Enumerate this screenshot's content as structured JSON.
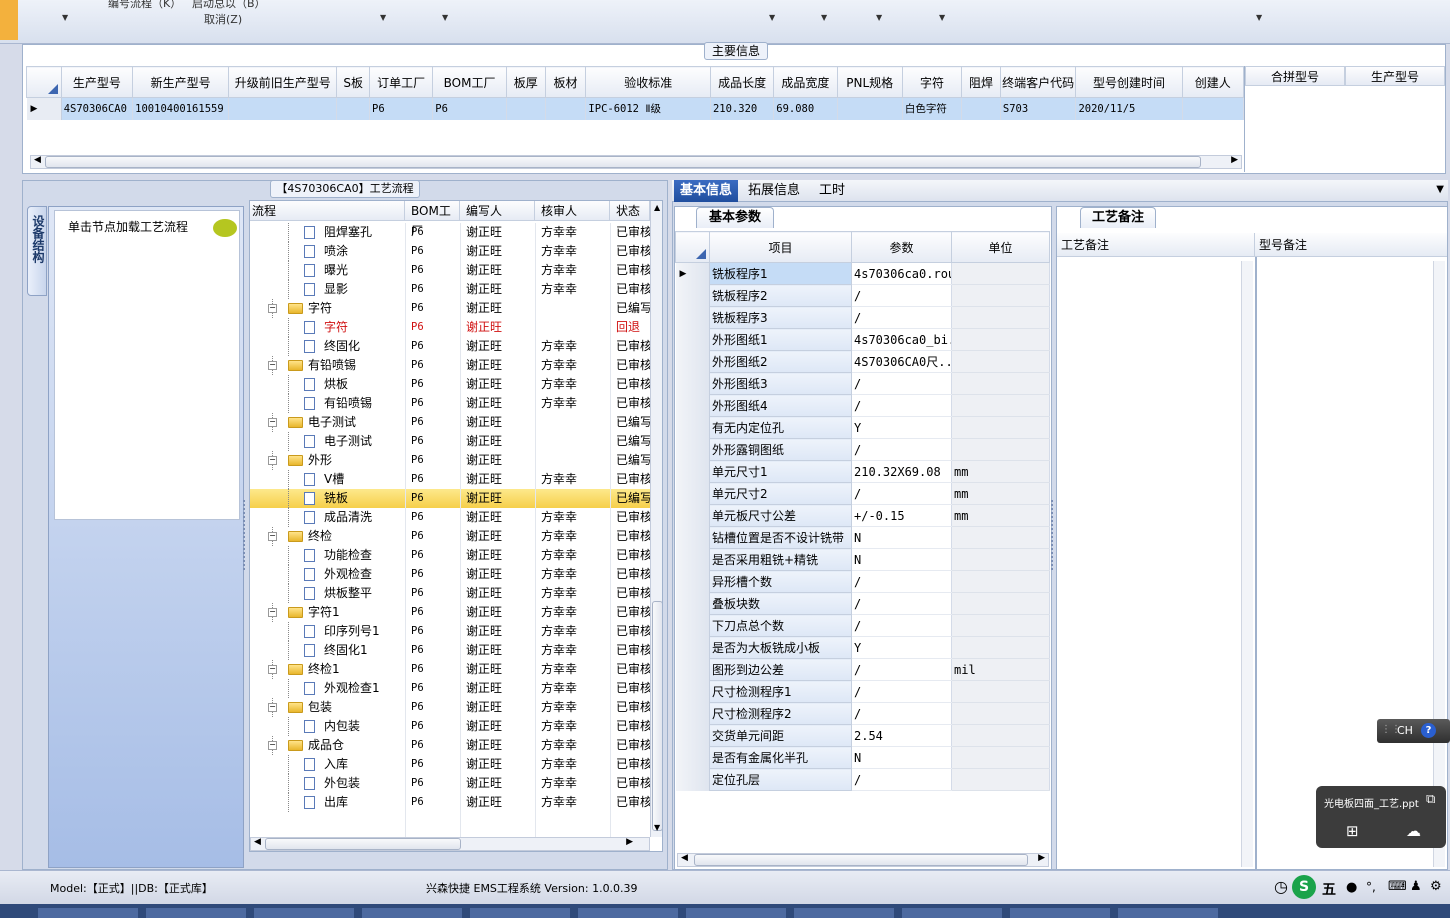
{
  "menu": {
    "item1": "编号流程（K）",
    "item2": "启动总以（B）",
    "item3": "取消(Z)"
  },
  "main_info": {
    "title": "主要信息",
    "columns": [
      "生产型号",
      "新生产型号",
      "升级前旧生产型号",
      "S板",
      "订单工厂",
      "BOM工厂",
      "板厚",
      "板材",
      "验收标准",
      "成品长度",
      "成品宽度",
      "PNL规格",
      "字符",
      "阻焊",
      "终端客户代码",
      "型号创建时间",
      "创建人"
    ],
    "row": [
      "4S70306CA0",
      "10010400161559",
      "",
      "",
      "P6",
      "P6",
      "",
      "",
      "IPC-6012 Ⅱ级",
      "210.320",
      "69.080",
      "",
      "白色字符",
      "",
      "S703",
      "2020/11/5",
      ""
    ],
    "side_columns": [
      "合拼型号",
      "生产型号"
    ]
  },
  "process": {
    "title": "【4S70306CA0】工艺流程",
    "side_tab": "设备结构",
    "load_hint": "单击节点加载工艺流程",
    "columns": [
      "流程",
      "BOM工厂",
      "编写人",
      "核审人",
      "状态"
    ],
    "rows": [
      {
        "name": "阻焊塞孔",
        "type": "file",
        "level": 1,
        "bom": "P6",
        "writer": "谢正旺",
        "reviewer": "方幸幸",
        "status": "已审核"
      },
      {
        "name": "喷涂",
        "type": "file",
        "level": 1,
        "bom": "P6",
        "writer": "谢正旺",
        "reviewer": "方幸幸",
        "status": "已审核"
      },
      {
        "name": "曝光",
        "type": "file",
        "level": 1,
        "bom": "P6",
        "writer": "谢正旺",
        "reviewer": "方幸幸",
        "status": "已审核"
      },
      {
        "name": "显影",
        "type": "file",
        "level": 1,
        "bom": "P6",
        "writer": "谢正旺",
        "reviewer": "方幸幸",
        "status": "已审核"
      },
      {
        "name": "字符",
        "type": "folder",
        "level": 0,
        "bom": "P6",
        "writer": "谢正旺",
        "reviewer": "",
        "status": "已编写"
      },
      {
        "name": "字符",
        "type": "file",
        "level": 1,
        "bom": "P6",
        "writer": "谢正旺",
        "reviewer": "",
        "status": "回退",
        "red": true
      },
      {
        "name": "终固化",
        "type": "file",
        "level": 1,
        "bom": "P6",
        "writer": "谢正旺",
        "reviewer": "方幸幸",
        "status": "已审核"
      },
      {
        "name": "有铅喷锡",
        "type": "folder",
        "level": 0,
        "bom": "P6",
        "writer": "谢正旺",
        "reviewer": "方幸幸",
        "status": "已审核"
      },
      {
        "name": "烘板",
        "type": "file",
        "level": 1,
        "bom": "P6",
        "writer": "谢正旺",
        "reviewer": "方幸幸",
        "status": "已审核"
      },
      {
        "name": "有铅喷锡",
        "type": "file",
        "level": 1,
        "bom": "P6",
        "writer": "谢正旺",
        "reviewer": "方幸幸",
        "status": "已审核"
      },
      {
        "name": "电子测试",
        "type": "folder",
        "level": 0,
        "bom": "P6",
        "writer": "谢正旺",
        "reviewer": "",
        "status": "已编写"
      },
      {
        "name": "电子测试",
        "type": "file",
        "level": 1,
        "bom": "P6",
        "writer": "谢正旺",
        "reviewer": "",
        "status": "已编写"
      },
      {
        "name": "外形",
        "type": "folder",
        "level": 0,
        "bom": "P6",
        "writer": "谢正旺",
        "reviewer": "",
        "status": "已编写"
      },
      {
        "name": "V槽",
        "type": "file",
        "level": 1,
        "bom": "P6",
        "writer": "谢正旺",
        "reviewer": "方幸幸",
        "status": "已审核"
      },
      {
        "name": "铣板",
        "type": "file",
        "level": 1,
        "bom": "P6",
        "writer": "谢正旺",
        "reviewer": "",
        "status": "已编写",
        "selected": true
      },
      {
        "name": "成品清洗",
        "type": "file",
        "level": 1,
        "bom": "P6",
        "writer": "谢正旺",
        "reviewer": "方幸幸",
        "status": "已审核"
      },
      {
        "name": "终检",
        "type": "folder",
        "level": 0,
        "bom": "P6",
        "writer": "谢正旺",
        "reviewer": "方幸幸",
        "status": "已审核"
      },
      {
        "name": "功能检查",
        "type": "file",
        "level": 1,
        "bom": "P6",
        "writer": "谢正旺",
        "reviewer": "方幸幸",
        "status": "已审核"
      },
      {
        "name": "外观检查",
        "type": "file",
        "level": 1,
        "bom": "P6",
        "writer": "谢正旺",
        "reviewer": "方幸幸",
        "status": "已审核"
      },
      {
        "name": "烘板整平",
        "type": "file",
        "level": 1,
        "bom": "P6",
        "writer": "谢正旺",
        "reviewer": "方幸幸",
        "status": "已审核"
      },
      {
        "name": "字符1",
        "type": "folder",
        "level": 0,
        "bom": "P6",
        "writer": "谢正旺",
        "reviewer": "方幸幸",
        "status": "已审核"
      },
      {
        "name": "印序列号1",
        "type": "file",
        "level": 1,
        "bom": "P6",
        "writer": "谢正旺",
        "reviewer": "方幸幸",
        "status": "已审核"
      },
      {
        "name": "终固化1",
        "type": "file",
        "level": 1,
        "bom": "P6",
        "writer": "谢正旺",
        "reviewer": "方幸幸",
        "status": "已审核"
      },
      {
        "name": "终检1",
        "type": "folder",
        "level": 0,
        "bom": "P6",
        "writer": "谢正旺",
        "reviewer": "方幸幸",
        "status": "已审核"
      },
      {
        "name": "外观检查1",
        "type": "file",
        "level": 1,
        "bom": "P6",
        "writer": "谢正旺",
        "reviewer": "方幸幸",
        "status": "已审核"
      },
      {
        "name": "包装",
        "type": "folder",
        "level": 0,
        "bom": "P6",
        "writer": "谢正旺",
        "reviewer": "方幸幸",
        "status": "已审核"
      },
      {
        "name": "内包装",
        "type": "file",
        "level": 1,
        "bom": "P6",
        "writer": "谢正旺",
        "reviewer": "方幸幸",
        "status": "已审核"
      },
      {
        "name": "成品仓",
        "type": "folder",
        "level": 0,
        "bom": "P6",
        "writer": "谢正旺",
        "reviewer": "方幸幸",
        "status": "已审核"
      },
      {
        "name": "入库",
        "type": "file",
        "level": 1,
        "bom": "P6",
        "writer": "谢正旺",
        "reviewer": "方幸幸",
        "status": "已审核"
      },
      {
        "name": "外包装",
        "type": "file",
        "level": 1,
        "bom": "P6",
        "writer": "谢正旺",
        "reviewer": "方幸幸",
        "status": "已审核"
      },
      {
        "name": "出库",
        "type": "file",
        "level": 1,
        "bom": "P6",
        "writer": "谢正旺",
        "reviewer": "方幸幸",
        "status": "已审核"
      }
    ]
  },
  "right_tabs": [
    "基本信息",
    "拓展信息",
    "工时"
  ],
  "basic": {
    "subtab": "基本参数",
    "columns": [
      "项目",
      "参数",
      "单位"
    ],
    "rows": [
      [
        "铣板程序1",
        "4s70306ca0.rou",
        ""
      ],
      [
        "铣板程序2",
        "/",
        ""
      ],
      [
        "铣板程序3",
        "/",
        ""
      ],
      [
        "外形图纸1",
        "4s70306ca0_bi...",
        ""
      ],
      [
        "外形图纸2",
        "4S70306CA0尺...",
        ""
      ],
      [
        "外形图纸3",
        "/",
        ""
      ],
      [
        "外形图纸4",
        "/",
        ""
      ],
      [
        "有无内定位孔",
        "Y",
        ""
      ],
      [
        "外形露铜图纸",
        "/",
        ""
      ],
      [
        "单元尺寸1",
        "210.32X69.08",
        "mm"
      ],
      [
        "单元尺寸2",
        "/",
        "mm"
      ],
      [
        "单元板尺寸公差",
        "+/-0.15",
        "mm"
      ],
      [
        "钻槽位置是否不设计铣带",
        "N",
        ""
      ],
      [
        "是否采用粗铣+精铣",
        "N",
        ""
      ],
      [
        "异形槽个数",
        "/",
        ""
      ],
      [
        "叠板块数",
        "/",
        ""
      ],
      [
        "下刀点总个数",
        "/",
        ""
      ],
      [
        "是否为大板铣成小板",
        "Y",
        ""
      ],
      [
        "图形到边公差",
        "/",
        "mil"
      ],
      [
        "尺寸检测程序1",
        "/",
        ""
      ],
      [
        "尺寸检测程序2",
        "/",
        ""
      ],
      [
        "交货单元间距",
        "2.54",
        ""
      ],
      [
        "是否有金属化半孔",
        "N",
        ""
      ],
      [
        "定位孔层",
        "/",
        ""
      ]
    ]
  },
  "remarks": {
    "tab": "工艺备注",
    "col1": "工艺备注",
    "col2": "型号备注"
  },
  "status": {
    "model": "Model:【正式】||DB:【正式库】",
    "app": "兴森快捷 EMS工程系统 Version: 1.0.0.39"
  },
  "ime": {
    "label": "CH"
  },
  "notification": {
    "file": "光电板四面_工艺.ppt"
  },
  "tray": {
    "ime_char": "五"
  }
}
